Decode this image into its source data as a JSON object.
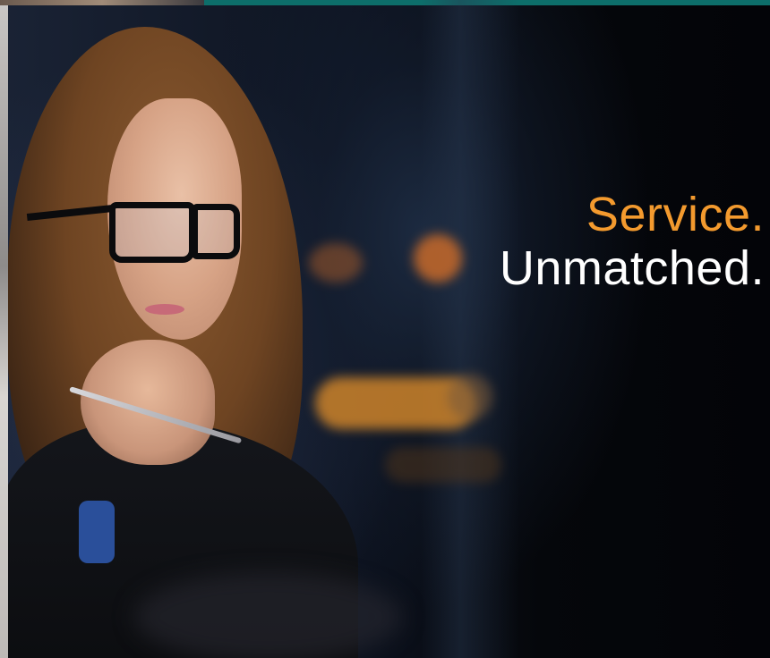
{
  "hero": {
    "headline_line1": "Service.",
    "headline_line2": "Unmatched.",
    "colors": {
      "accent_orange": "#f39a2e",
      "headline_white": "#ffffff",
      "top_bar_teal": "#0d6e6a",
      "background": "#05070b"
    },
    "image": "woman-with-glasses-thinking-photo"
  }
}
